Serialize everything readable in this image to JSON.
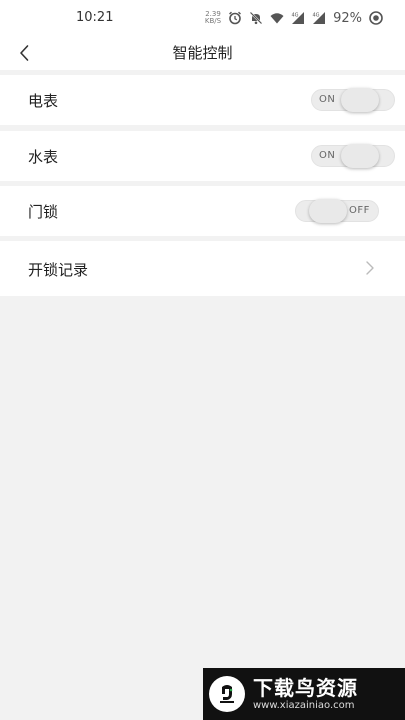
{
  "status_bar": {
    "time": "10:21",
    "net_speed_value": "2.39",
    "net_speed_unit": "KB/S",
    "network_label_1": "4G",
    "network_label_2": "4G",
    "battery": "92%"
  },
  "nav": {
    "title": "智能控制",
    "back_icon": "chevron-left-icon"
  },
  "settings": {
    "electric_meter": {
      "label": "电表",
      "state": "ON",
      "on": true
    },
    "water_meter": {
      "label": "水表",
      "state": "ON",
      "on": true
    },
    "door_lock": {
      "label": "门锁",
      "state": "OFF",
      "on": false
    },
    "unlock_records": {
      "label": "开锁记录",
      "icon": "chevron-right-icon"
    }
  },
  "watermark": {
    "title": "下载鸟资源",
    "url": "www.xiazainiao.com"
  },
  "colors": {
    "background": "#f2f2f2",
    "row_background": "#ffffff",
    "toggle_track": "#ececec",
    "watermark_background": "#111111"
  }
}
